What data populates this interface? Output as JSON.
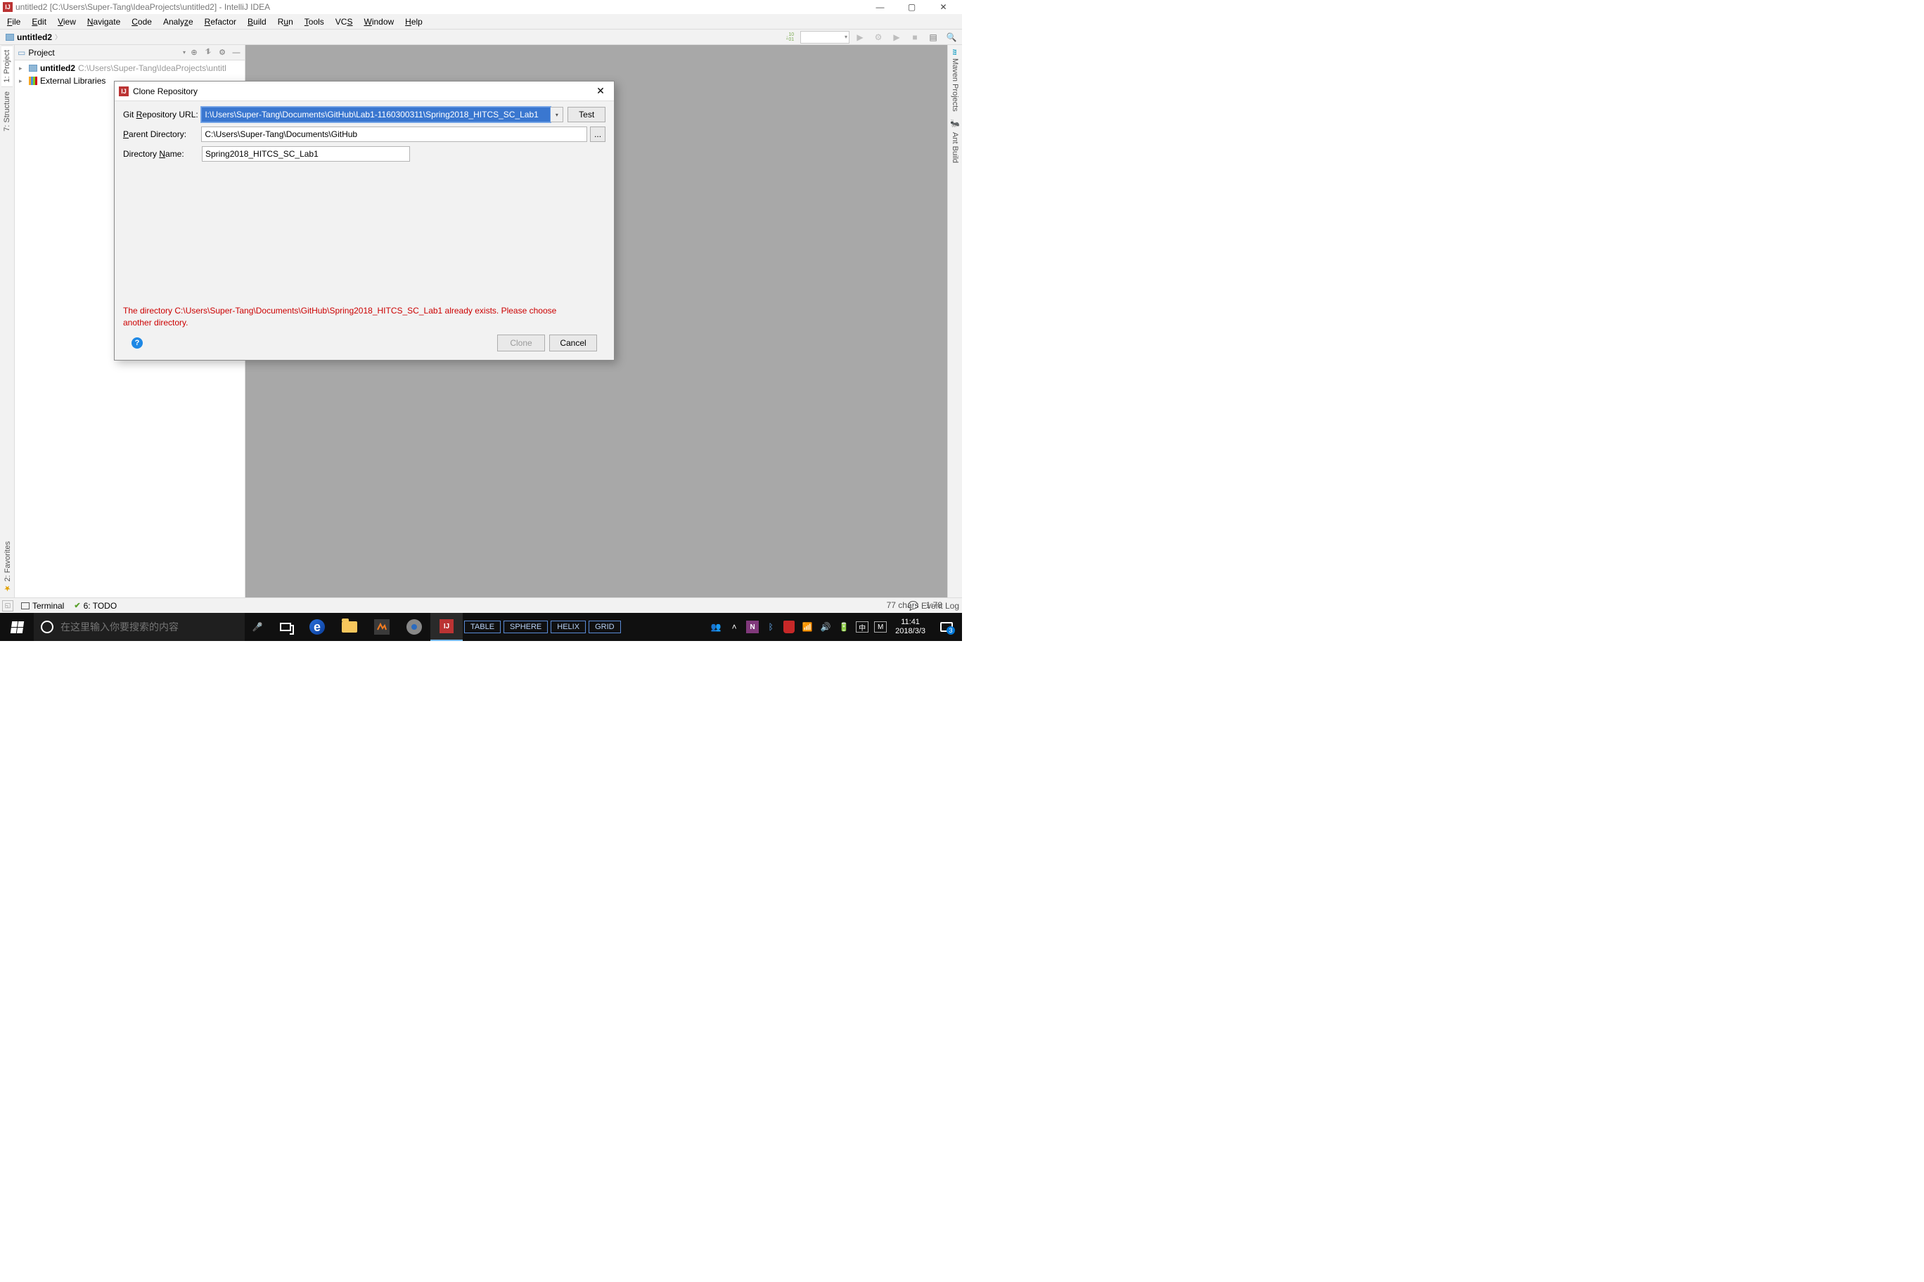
{
  "window": {
    "title": "untitled2 [C:\\Users\\Super-Tang\\IdeaProjects\\untitled2] - IntelliJ IDEA"
  },
  "menus": [
    "File",
    "Edit",
    "View",
    "Navigate",
    "Code",
    "Analyze",
    "Refactor",
    "Build",
    "Run",
    "Tools",
    "VCS",
    "Window",
    "Help"
  ],
  "breadcrumb": {
    "project": "untitled2"
  },
  "left_tabs": {
    "project": "1: Project",
    "structure": "7: Structure",
    "favorites": "2: Favorites"
  },
  "right_tabs": {
    "maven": "Maven Projects",
    "ant": "Ant Build"
  },
  "project_panel": {
    "selector": "Project",
    "root": {
      "name": "untitled2",
      "path": "C:\\Users\\Super-Tang\\IdeaProjects\\untitl"
    },
    "ext_libs": "External Libraries"
  },
  "dialog": {
    "title": "Clone Repository",
    "labels": {
      "url": "Git Repository URL:",
      "parent": "Parent Directory:",
      "dir": "Directory Name:"
    },
    "values": {
      "url": "C:\\Users\\Super-Tang\\Documents\\GitHub\\Lab1-1160300311\\Spring2018_HITCS_SC_Lab1",
      "url_display": "I:\\Users\\Super-Tang\\Documents\\GitHub\\Lab1-1160300311\\Spring2018_HITCS_SC_Lab1",
      "parent": "C:\\Users\\Super-Tang\\Documents\\GitHub",
      "dir": "Spring2018_HITCS_SC_Lab1"
    },
    "buttons": {
      "test": "Test",
      "browse": "...",
      "clone": "Clone",
      "cancel": "Cancel"
    },
    "error": "The directory C:\\Users\\Super-Tang\\Documents\\GitHub\\Spring2018_HITCS_SC_Lab1 already exists. Please choose another directory."
  },
  "status": {
    "terminal": "Terminal",
    "todo": "6: TODO",
    "event_log": "Event Log",
    "chars": "77 chars",
    "pos": "1:78"
  },
  "taskbar": {
    "search_placeholder": "在这里输入你要搜索的内容",
    "tabs": [
      "TABLE",
      "SPHERE",
      "HELIX",
      "GRID"
    ],
    "ime1": "中",
    "ime2": "M",
    "time": "11:41",
    "date": "2018/3/3",
    "notif_count": "3",
    "people_icon": "people",
    "onenote": "N"
  }
}
